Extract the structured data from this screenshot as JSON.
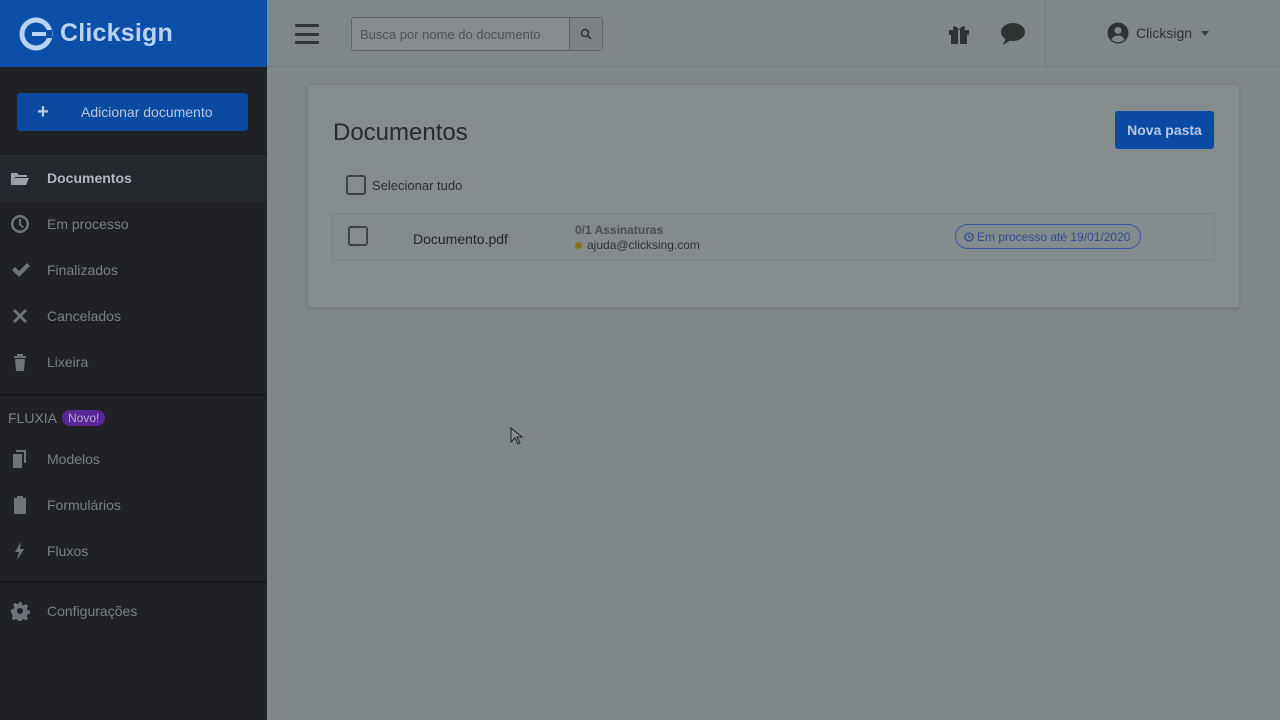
{
  "brand": {
    "name": "Clicksign"
  },
  "sidebar": {
    "add_label": "Adicionar documento",
    "items": [
      {
        "label": "Documentos",
        "icon": "folder-open-icon"
      },
      {
        "label": "Em processo",
        "icon": "clock-icon"
      },
      {
        "label": "Finalizados",
        "icon": "check-icon"
      },
      {
        "label": "Cancelados",
        "icon": "x-icon"
      },
      {
        "label": "Lixeira",
        "icon": "trash-icon"
      }
    ],
    "section": {
      "title": "FLUXIA",
      "badge": "Novo!"
    },
    "fluxia_items": [
      {
        "label": "Modelos",
        "icon": "copy-document-icon"
      },
      {
        "label": "Formulários",
        "icon": "clipboard-icon"
      },
      {
        "label": "Fluxos",
        "icon": "bolt-icon"
      }
    ],
    "settings": {
      "label": "Configurações",
      "icon": "gear-icon"
    }
  },
  "topbar": {
    "search_placeholder": "Busca por nome do documento",
    "user_name": "Clicksign"
  },
  "main": {
    "title": "Documentos",
    "new_folder_label": "Nova pasta",
    "select_all_label": "Selecionar tudo",
    "documents": [
      {
        "name": "Documento.pdf",
        "signatures": "0/1 Assinaturas",
        "signer_email": "ajuda@clicksing.com",
        "status": "Em processo até 19/01/2020"
      }
    ]
  },
  "colors": {
    "brand_blue": "#0b4fa8",
    "sidebar_bg": "#1f2124",
    "badge_purple": "#5a2596",
    "pending_dot": "#8a6f12"
  }
}
